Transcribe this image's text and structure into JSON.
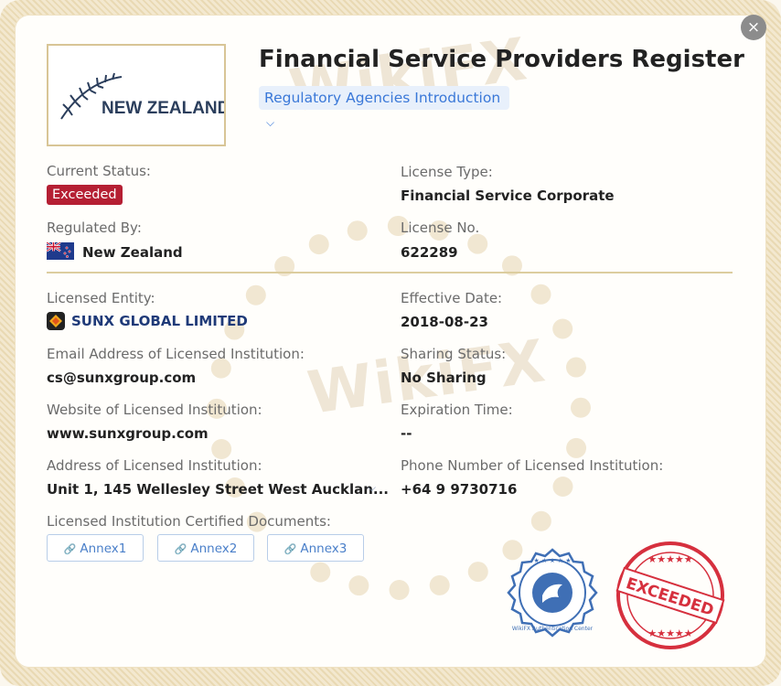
{
  "header": {
    "title": "Financial Service Providers Register",
    "agency_link": "Regulatory Agencies Introduction",
    "close_label": "×"
  },
  "logo": {
    "text": "NEW ZEALAND"
  },
  "watermark": "WikiFX",
  "fields": {
    "current_status_label": "Current Status:",
    "current_status_value": "Exceeded",
    "license_type_label": "License Type:",
    "license_type_value": "Financial Service Corporate",
    "regulated_by_label": "Regulated By:",
    "regulated_by_value": "New Zealand",
    "license_no_label": "License No.",
    "license_no_value": "622289",
    "licensed_entity_label": "Licensed Entity:",
    "licensed_entity_value": "SUNX GLOBAL LIMITED",
    "effective_date_label": "Effective Date:",
    "effective_date_value": "2018-08-23",
    "email_label": "Email Address of Licensed Institution:",
    "email_value": "cs@sunxgroup.com",
    "sharing_status_label": "Sharing Status:",
    "sharing_status_value": "No Sharing",
    "website_label": "Website of Licensed Institution:",
    "website_value": "www.sunxgroup.com",
    "expiration_label": "Expiration Time:",
    "expiration_value": "--",
    "address_label": "Address of Licensed Institution:",
    "address_value": "Unit 1, 145 Wellesley Street West Aucklan...",
    "phone_label": "Phone Number of Licensed Institution:",
    "phone_value": "+64 9 9730716",
    "documents_label": "Licensed Institution Certified Documents:"
  },
  "documents": [
    {
      "label": "Annex1"
    },
    {
      "label": "Annex2"
    },
    {
      "label": "Annex3"
    }
  ],
  "stamps": {
    "auth_text": "WikiFX Authentication Center",
    "exceeded_text": "EXCEEDED"
  },
  "colors": {
    "status_exceeded": "#b51f33",
    "link_blue": "#3a78d8",
    "gold_border": "#d8c596"
  }
}
